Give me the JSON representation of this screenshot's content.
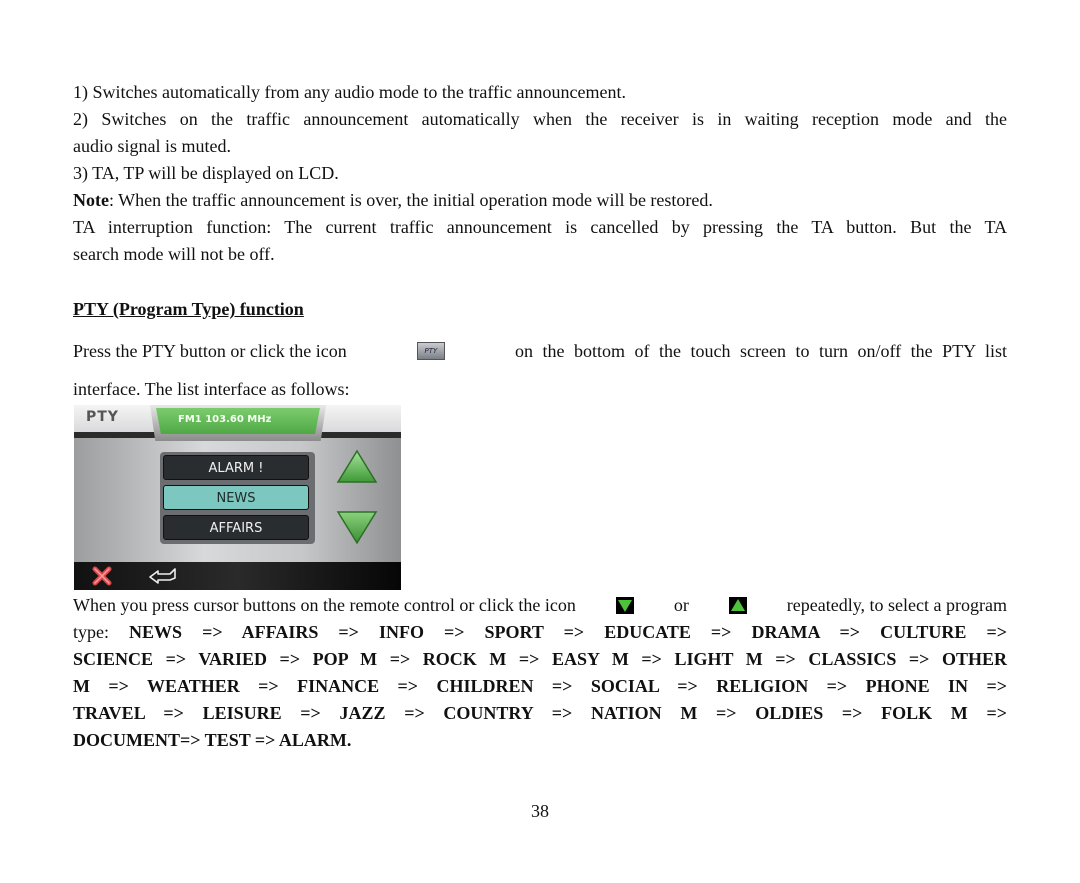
{
  "paragraphs": {
    "p1": "1) Switches automatically from any audio mode to the traffic announcement.",
    "p2_line1": "2) Switches on the traffic announcement automatically when the receiver is in waiting reception mode and the",
    "p2_line2": "audio signal is muted.",
    "p3": "3) TA, TP will be displayed on LCD.",
    "note_label": "Note",
    "note_text": ": When the traffic announcement is over, the initial operation mode will be restored.",
    "ta_line1": "TA interruption function: The current traffic announcement is cancelled by pressing the TA button. But the TA",
    "ta_line2": "search mode will not be off."
  },
  "section": {
    "heading": "PTY (Program Type) function",
    "press_before": "Press the PTY button or click the icon",
    "press_icon": "PTY",
    "press_after": "on the bottom of the touch screen to turn on/off the PTY list",
    "press_line2": "interface. The list interface as follows:",
    "cursor_before": "When you press cursor buttons on the remote control or click the icon",
    "cursor_or": "or",
    "cursor_after": "repeatedly, to select a program",
    "type_label": "type:"
  },
  "program_types_lines": [
    "NEWS => AFFAIRS => INFO => SPORT => EDUCATE => DRAMA => CULTURE =>",
    "SCIENCE => VARIED => POP M => ROCK M => EASY M => LIGHT M => CLASSICS => OTHER",
    "M => WEATHER => FINANCE => CHILDREN => SOCIAL => RELIGION => PHONE IN =>",
    "TRAVEL => LEISURE => JAZZ => COUNTRY => NATION M => OLDIES => FOLK M =>",
    "DOCUMENT=> TEST => ALARM."
  ],
  "device": {
    "title": "PTY",
    "frequency": "FM1 103.60 MHz",
    "items": [
      {
        "label": "ALARM !",
        "selected": false
      },
      {
        "label": "NEWS",
        "selected": true
      },
      {
        "label": "AFFAIRS",
        "selected": false
      }
    ],
    "colors": {
      "accent_green": "#5cb84f",
      "selected_item": "#7cc7c0",
      "close_red": "#e0454a"
    }
  },
  "page_number": "38"
}
